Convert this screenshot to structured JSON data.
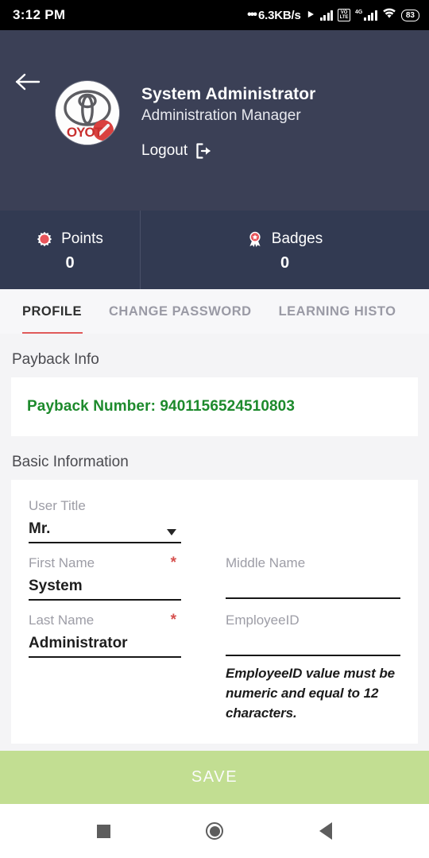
{
  "status_bar": {
    "time": "3:12 PM",
    "network_speed": "6.3KB/s",
    "bluetooth_icon": "bluetooth-icon",
    "signal_icon": "cellular-signal-icon",
    "volte_label_top": "VO",
    "volte_label_bottom": "LTE",
    "network_type": "4G",
    "wifi_icon": "wifi-icon",
    "battery_level": "83"
  },
  "header": {
    "back_icon": "back-arrow-icon",
    "avatar_icon": "toyota-logo-avatar",
    "user_name": "System Administrator",
    "user_role": "Administration Manager",
    "logout_label": "Logout",
    "logout_icon": "logout-icon",
    "background_color": "#3b4056"
  },
  "stats": {
    "background_color": "#323a52",
    "items": [
      {
        "icon": "points-starburst-icon",
        "label": "Points",
        "value": "0",
        "accent": "#e8545a"
      },
      {
        "icon": "badge-ribbon-icon",
        "label": "Badges",
        "value": "0",
        "accent": "#e8545a"
      }
    ]
  },
  "tabs": {
    "active_index": 0,
    "active_indicator_color": "#e05a5a",
    "items": [
      {
        "label": "PROFILE"
      },
      {
        "label": "CHANGE PASSWORD"
      },
      {
        "label": "LEARNING HISTO"
      }
    ]
  },
  "content": {
    "payback": {
      "section_title": "Payback Info",
      "payback_text": "Payback Number: 9401156524510803",
      "payback_color": "#1d8a2c"
    },
    "basic_information": {
      "section_title": "Basic Information",
      "fields": {
        "user_title": {
          "label": "User Title",
          "value": "Mr.",
          "type": "select",
          "caret_icon": "chevron-down-icon"
        },
        "first_name": {
          "label": "First Name",
          "value": "System",
          "required_marker": "*"
        },
        "middle_name": {
          "label": "Middle Name",
          "value": "",
          "placeholder": ""
        },
        "last_name": {
          "label": "Last Name",
          "value": "Administrator",
          "required_marker": "*"
        },
        "employee_id": {
          "label": "EmployeeID",
          "value": "",
          "placeholder": "",
          "hint": "EmployeeID value must be numeric and equal to 12 characters."
        }
      }
    }
  },
  "save_bar": {
    "label": "SAVE",
    "background_color": "#c2de92"
  },
  "android_nav": {
    "recents_icon": "square-recents-icon",
    "home_icon": "circle-home-icon",
    "back_icon": "triangle-back-icon"
  }
}
